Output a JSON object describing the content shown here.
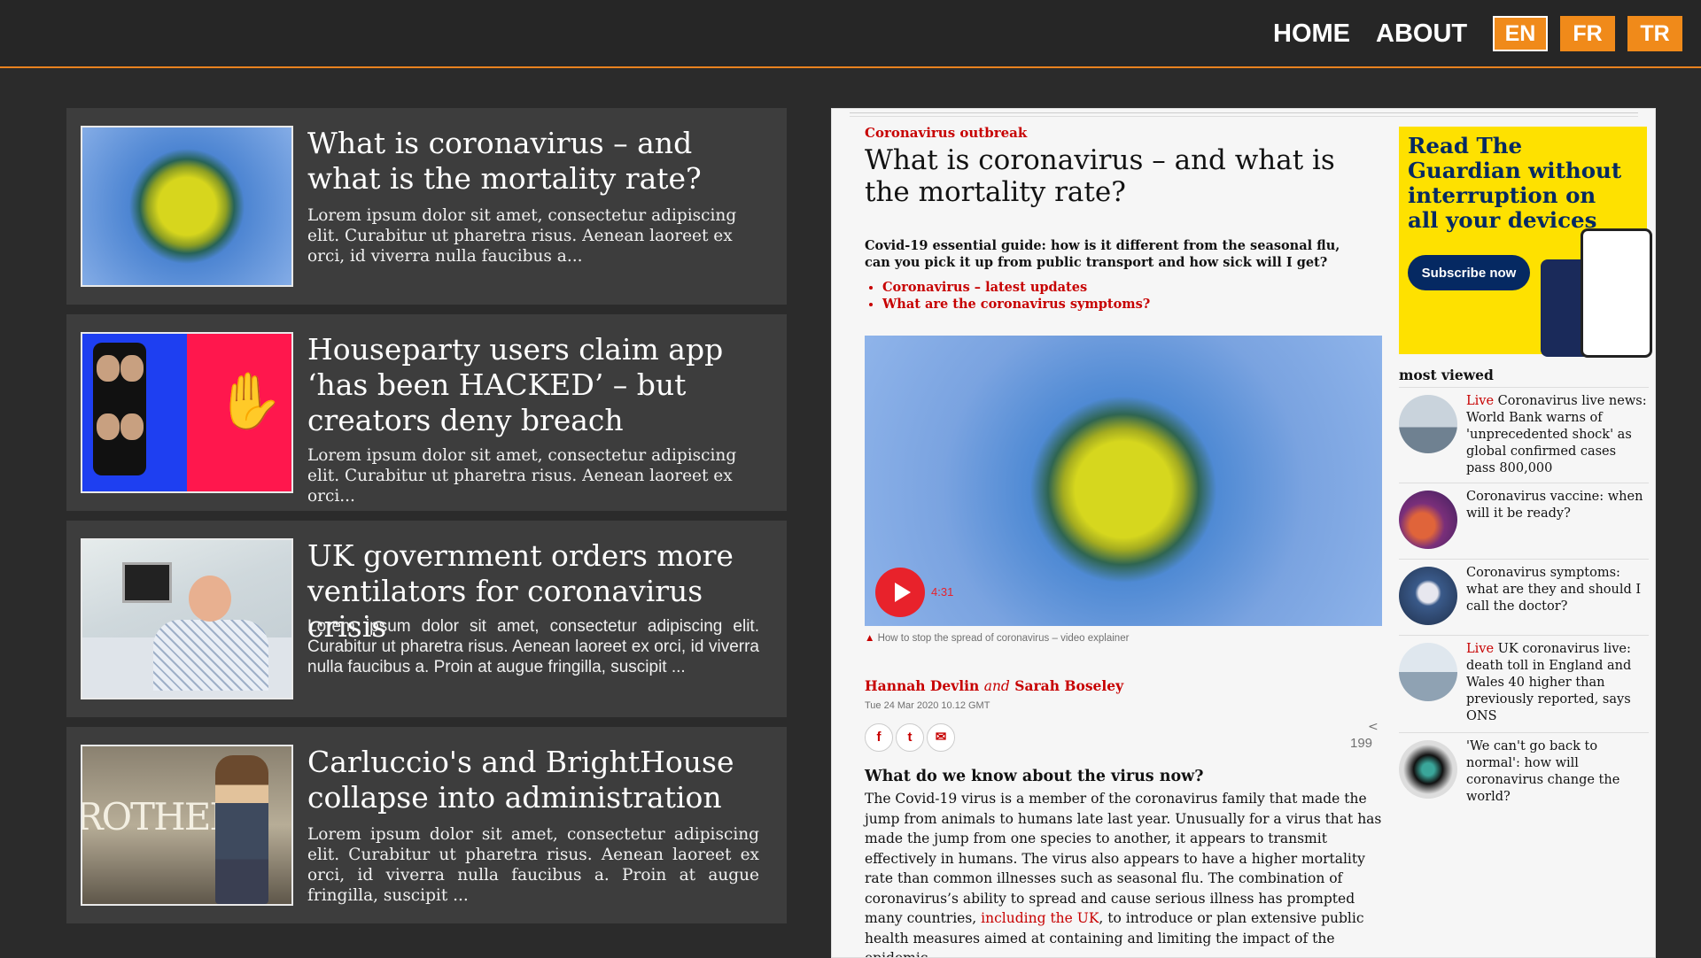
{
  "nav": {
    "home": "HOME",
    "about": "ABOUT",
    "languages": [
      "EN",
      "FR",
      "TR"
    ]
  },
  "articles": [
    {
      "title": "What is coronavirus – and what is the mortality rate?",
      "excerpt": "Lorem ipsum dolor sit amet, consectetur adipiscing elit. Curabitur ut pharetra risus. Aenean laoreet ex orci, id viverra nulla faucibus a..."
    },
    {
      "title": "Houseparty users claim app ‘has been HACKED’ – but creators deny breach",
      "excerpt": "Lorem ipsum dolor sit amet, consectetur adipiscing elit. Curabitur ut pharetra risus. Aenean laoreet ex orci..."
    },
    {
      "title": "UK government orders more ventilators for coronavirus crisis",
      "excerpt": "Lorem ipsum dolor sit amet, consectetur adipiscing elit. Curabitur ut pharetra risus. Aenean laoreet ex orci, id viverra nulla faucibus a. Proin at augue fringilla, suscipit ..."
    },
    {
      "title": "Carluccio's and BrightHouse collapse into administration",
      "excerpt": "Lorem ipsum dolor sit amet, consectetur adipiscing elit. Curabitur ut pharetra risus. Aenean laoreet ex orci, id viverra nulla faucibus a. Proin at augue fringilla, suscipit ..."
    }
  ],
  "thumb_text": {
    "brothers": "ROTHERS"
  },
  "detail": {
    "kicker": "Coronavirus outbreak",
    "title": "What is coronavirus – and what is the mortality rate?",
    "standfirst": "Covid-19 essential guide: how is it different from the seasonal flu, can you pick it up from public transport and how sick will I get?",
    "links": [
      "Coronavirus – latest updates",
      "What are the coronavirus symptoms?"
    ],
    "video_duration": "4:31",
    "caption": "How to stop the spread of coronavirus – video explainer",
    "author1": "Hannah Devlin",
    "author_and": "and",
    "author2": "Sarah Boseley",
    "date": "Tue 24 Mar 2020 10.12 GMT",
    "share_count": "199",
    "subheading": "What do we know about the virus now?",
    "body_before_link": "The Covid-19 virus is a member of the coronavirus family that made the jump from animals to humans late last year. Unusually for a virus that has made the jump from one species to another, it appears to transmit effectively in humans. The virus also appears to have a higher mortality rate than common illnesses such as seasonal flu. The combination of coronavirus’s ability to spread and cause serious illness has prompted many countries, ",
    "body_link": "including the UK",
    "body_after_link": ", to introduce or plan extensive public health measures aimed at containing and limiting the impact of the epidemic.",
    "ad_text": "Read The Guardian without interruption on all your devices",
    "ad_button": "Subscribe now",
    "most_viewed_title": "most viewed",
    "most_viewed": [
      {
        "live": "Live",
        "text": "Coronavirus live news: World Bank warns of 'unprecedented shock' as global confirmed cases pass 800,000"
      },
      {
        "live": "",
        "text": "Coronavirus vaccine: when will it be ready?"
      },
      {
        "live": "",
        "text": "Coronavirus symptoms: what are they and should I call the doctor?"
      },
      {
        "live": "Live",
        "text": "UK coronavirus live: death toll in England and Wales 40 higher than previously reported, says ONS"
      },
      {
        "live": "",
        "text": "'We can't go back to normal': how will coronavirus change the world?"
      }
    ]
  },
  "colors": {
    "accent": "#f08a1a",
    "guardian_red": "#c70000",
    "guardian_blue": "#052962",
    "ad_yellow": "#fee100"
  }
}
